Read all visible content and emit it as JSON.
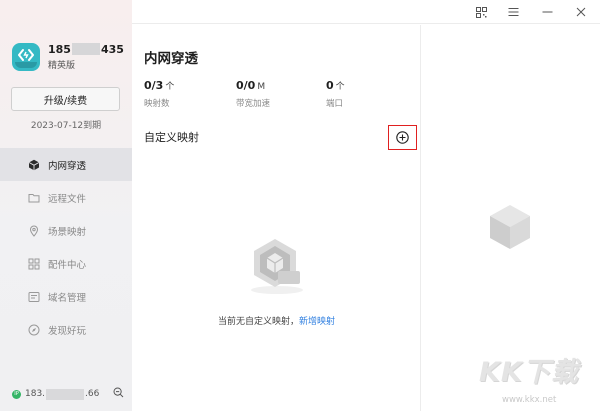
{
  "user": {
    "phone_prefix": "185",
    "phone_suffix": "435",
    "tier": "精英版",
    "upgrade_label": "升级/续费",
    "expiry": "2023-07-12到期"
  },
  "nav": {
    "items": [
      {
        "label": "内网穿透",
        "icon": "cube-icon",
        "active": true
      },
      {
        "label": "远程文件",
        "icon": "folder-icon"
      },
      {
        "label": "场景映射",
        "icon": "map-pin-icon"
      },
      {
        "label": "配件中心",
        "icon": "grid-icon"
      },
      {
        "label": "域名管理",
        "icon": "domain-icon"
      },
      {
        "label": "发现好玩",
        "icon": "compass-icon"
      }
    ]
  },
  "footer": {
    "ip_badge": "IP",
    "ip_prefix": "183.",
    "ip_suffix": ".66"
  },
  "titlebar": {
    "icons": [
      "qrcode-icon",
      "menu-icon",
      "minimize-icon",
      "close-icon"
    ]
  },
  "main": {
    "title": "内网穿透",
    "stats": [
      {
        "value": "0/3",
        "unit": "个",
        "label": "映射数"
      },
      {
        "value": "0/0",
        "unit": "M",
        "label": "带宽加速"
      },
      {
        "value": "0",
        "unit": "个",
        "label": "端口"
      }
    ],
    "section_title": "自定义映射",
    "empty_text": "当前无自定义映射，",
    "empty_link": "新增映射"
  },
  "watermark": {
    "text": "KK下载",
    "url": "www.kkx.net"
  },
  "colors": {
    "accent_link": "#2f7fe0",
    "highlight_box": "#e02020",
    "ip_badge": "#34b566",
    "avatar": "#35b9c4"
  }
}
